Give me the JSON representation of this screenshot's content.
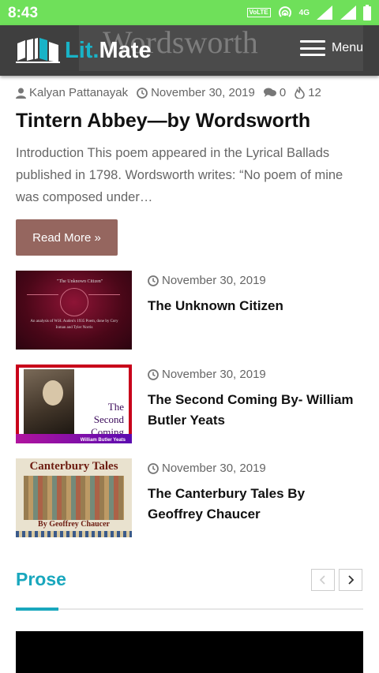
{
  "status_bar": {
    "time": "8:43",
    "volte": "VoLTE",
    "network": "4G",
    "color": "#6fe05a"
  },
  "header": {
    "logo_part1": "Lit.",
    "logo_part2": "Mate",
    "bg_text": "Wordsworth",
    "menu_label": "Menu",
    "accent_color": "#19b3c7"
  },
  "post": {
    "author": "Kalyan Pattanayak",
    "date": "November 30, 2019",
    "comments": "0",
    "views": "12",
    "title": "Tintern Abbey—by Wordsworth",
    "excerpt": "Introduction This poem appeared in the Lyrical Ballads published in 1798. Wordsworth writes: “No poem of mine was composed under…",
    "read_more": "Read More »"
  },
  "related_posts": [
    {
      "date": "November 30, 2019",
      "title": "The Unknown Citizen",
      "thumb_caption": "\"The Unknown Citizen\"",
      "thumb_subtitle": "An analysis of W.H. Auden's 1935 Poem, done by Cory Inman and Tyler Norris"
    },
    {
      "date": "November 30, 2019",
      "title": "The Second Coming By- William Butler Yeats",
      "thumb_line1": "The",
      "thumb_line2": "Second",
      "thumb_line3": "Coming",
      "thumb_author": "William Butler Yeats"
    },
    {
      "date": "November 30, 2019",
      "title": "The Canterbury Tales By Geoffrey Chaucer",
      "thumb_title": "Canterbury Tales",
      "thumb_author": "By Geoffrey Chaucer"
    }
  ],
  "section": {
    "title": "Prose",
    "accent_color": "#19a7bd"
  },
  "icons": {
    "author": "user-icon",
    "date": "clock-icon",
    "comments": "comments-icon",
    "views": "fire-icon",
    "prev": "chevron-left-icon",
    "next": "chevron-right-icon",
    "menu": "hamburger-icon"
  },
  "colors": {
    "read_more_bg": "#95665f",
    "header_bg": "#3f3f3f"
  }
}
